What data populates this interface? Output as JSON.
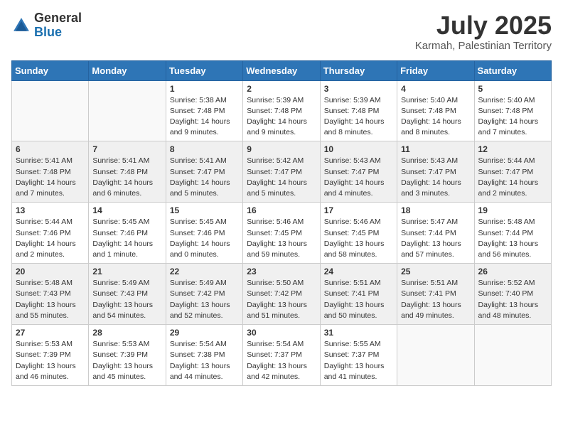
{
  "header": {
    "logo_general": "General",
    "logo_blue": "Blue",
    "month": "July 2025",
    "location": "Karmah, Palestinian Territory"
  },
  "days_of_week": [
    "Sunday",
    "Monday",
    "Tuesday",
    "Wednesday",
    "Thursday",
    "Friday",
    "Saturday"
  ],
  "weeks": [
    [
      {
        "day": "",
        "sunrise": "",
        "sunset": "",
        "daylight": ""
      },
      {
        "day": "",
        "sunrise": "",
        "sunset": "",
        "daylight": ""
      },
      {
        "day": "1",
        "sunrise": "Sunrise: 5:38 AM",
        "sunset": "Sunset: 7:48 PM",
        "daylight": "Daylight: 14 hours and 9 minutes."
      },
      {
        "day": "2",
        "sunrise": "Sunrise: 5:39 AM",
        "sunset": "Sunset: 7:48 PM",
        "daylight": "Daylight: 14 hours and 9 minutes."
      },
      {
        "day": "3",
        "sunrise": "Sunrise: 5:39 AM",
        "sunset": "Sunset: 7:48 PM",
        "daylight": "Daylight: 14 hours and 8 minutes."
      },
      {
        "day": "4",
        "sunrise": "Sunrise: 5:40 AM",
        "sunset": "Sunset: 7:48 PM",
        "daylight": "Daylight: 14 hours and 8 minutes."
      },
      {
        "day": "5",
        "sunrise": "Sunrise: 5:40 AM",
        "sunset": "Sunset: 7:48 PM",
        "daylight": "Daylight: 14 hours and 7 minutes."
      }
    ],
    [
      {
        "day": "6",
        "sunrise": "Sunrise: 5:41 AM",
        "sunset": "Sunset: 7:48 PM",
        "daylight": "Daylight: 14 hours and 7 minutes."
      },
      {
        "day": "7",
        "sunrise": "Sunrise: 5:41 AM",
        "sunset": "Sunset: 7:48 PM",
        "daylight": "Daylight: 14 hours and 6 minutes."
      },
      {
        "day": "8",
        "sunrise": "Sunrise: 5:41 AM",
        "sunset": "Sunset: 7:47 PM",
        "daylight": "Daylight: 14 hours and 5 minutes."
      },
      {
        "day": "9",
        "sunrise": "Sunrise: 5:42 AM",
        "sunset": "Sunset: 7:47 PM",
        "daylight": "Daylight: 14 hours and 5 minutes."
      },
      {
        "day": "10",
        "sunrise": "Sunrise: 5:43 AM",
        "sunset": "Sunset: 7:47 PM",
        "daylight": "Daylight: 14 hours and 4 minutes."
      },
      {
        "day": "11",
        "sunrise": "Sunrise: 5:43 AM",
        "sunset": "Sunset: 7:47 PM",
        "daylight": "Daylight: 14 hours and 3 minutes."
      },
      {
        "day": "12",
        "sunrise": "Sunrise: 5:44 AM",
        "sunset": "Sunset: 7:47 PM",
        "daylight": "Daylight: 14 hours and 2 minutes."
      }
    ],
    [
      {
        "day": "13",
        "sunrise": "Sunrise: 5:44 AM",
        "sunset": "Sunset: 7:46 PM",
        "daylight": "Daylight: 14 hours and 2 minutes."
      },
      {
        "day": "14",
        "sunrise": "Sunrise: 5:45 AM",
        "sunset": "Sunset: 7:46 PM",
        "daylight": "Daylight: 14 hours and 1 minute."
      },
      {
        "day": "15",
        "sunrise": "Sunrise: 5:45 AM",
        "sunset": "Sunset: 7:46 PM",
        "daylight": "Daylight: 14 hours and 0 minutes."
      },
      {
        "day": "16",
        "sunrise": "Sunrise: 5:46 AM",
        "sunset": "Sunset: 7:45 PM",
        "daylight": "Daylight: 13 hours and 59 minutes."
      },
      {
        "day": "17",
        "sunrise": "Sunrise: 5:46 AM",
        "sunset": "Sunset: 7:45 PM",
        "daylight": "Daylight: 13 hours and 58 minutes."
      },
      {
        "day": "18",
        "sunrise": "Sunrise: 5:47 AM",
        "sunset": "Sunset: 7:44 PM",
        "daylight": "Daylight: 13 hours and 57 minutes."
      },
      {
        "day": "19",
        "sunrise": "Sunrise: 5:48 AM",
        "sunset": "Sunset: 7:44 PM",
        "daylight": "Daylight: 13 hours and 56 minutes."
      }
    ],
    [
      {
        "day": "20",
        "sunrise": "Sunrise: 5:48 AM",
        "sunset": "Sunset: 7:43 PM",
        "daylight": "Daylight: 13 hours and 55 minutes."
      },
      {
        "day": "21",
        "sunrise": "Sunrise: 5:49 AM",
        "sunset": "Sunset: 7:43 PM",
        "daylight": "Daylight: 13 hours and 54 minutes."
      },
      {
        "day": "22",
        "sunrise": "Sunrise: 5:49 AM",
        "sunset": "Sunset: 7:42 PM",
        "daylight": "Daylight: 13 hours and 52 minutes."
      },
      {
        "day": "23",
        "sunrise": "Sunrise: 5:50 AM",
        "sunset": "Sunset: 7:42 PM",
        "daylight": "Daylight: 13 hours and 51 minutes."
      },
      {
        "day": "24",
        "sunrise": "Sunrise: 5:51 AM",
        "sunset": "Sunset: 7:41 PM",
        "daylight": "Daylight: 13 hours and 50 minutes."
      },
      {
        "day": "25",
        "sunrise": "Sunrise: 5:51 AM",
        "sunset": "Sunset: 7:41 PM",
        "daylight": "Daylight: 13 hours and 49 minutes."
      },
      {
        "day": "26",
        "sunrise": "Sunrise: 5:52 AM",
        "sunset": "Sunset: 7:40 PM",
        "daylight": "Daylight: 13 hours and 48 minutes."
      }
    ],
    [
      {
        "day": "27",
        "sunrise": "Sunrise: 5:53 AM",
        "sunset": "Sunset: 7:39 PM",
        "daylight": "Daylight: 13 hours and 46 minutes."
      },
      {
        "day": "28",
        "sunrise": "Sunrise: 5:53 AM",
        "sunset": "Sunset: 7:39 PM",
        "daylight": "Daylight: 13 hours and 45 minutes."
      },
      {
        "day": "29",
        "sunrise": "Sunrise: 5:54 AM",
        "sunset": "Sunset: 7:38 PM",
        "daylight": "Daylight: 13 hours and 44 minutes."
      },
      {
        "day": "30",
        "sunrise": "Sunrise: 5:54 AM",
        "sunset": "Sunset: 7:37 PM",
        "daylight": "Daylight: 13 hours and 42 minutes."
      },
      {
        "day": "31",
        "sunrise": "Sunrise: 5:55 AM",
        "sunset": "Sunset: 7:37 PM",
        "daylight": "Daylight: 13 hours and 41 minutes."
      },
      {
        "day": "",
        "sunrise": "",
        "sunset": "",
        "daylight": ""
      },
      {
        "day": "",
        "sunrise": "",
        "sunset": "",
        "daylight": ""
      }
    ]
  ]
}
